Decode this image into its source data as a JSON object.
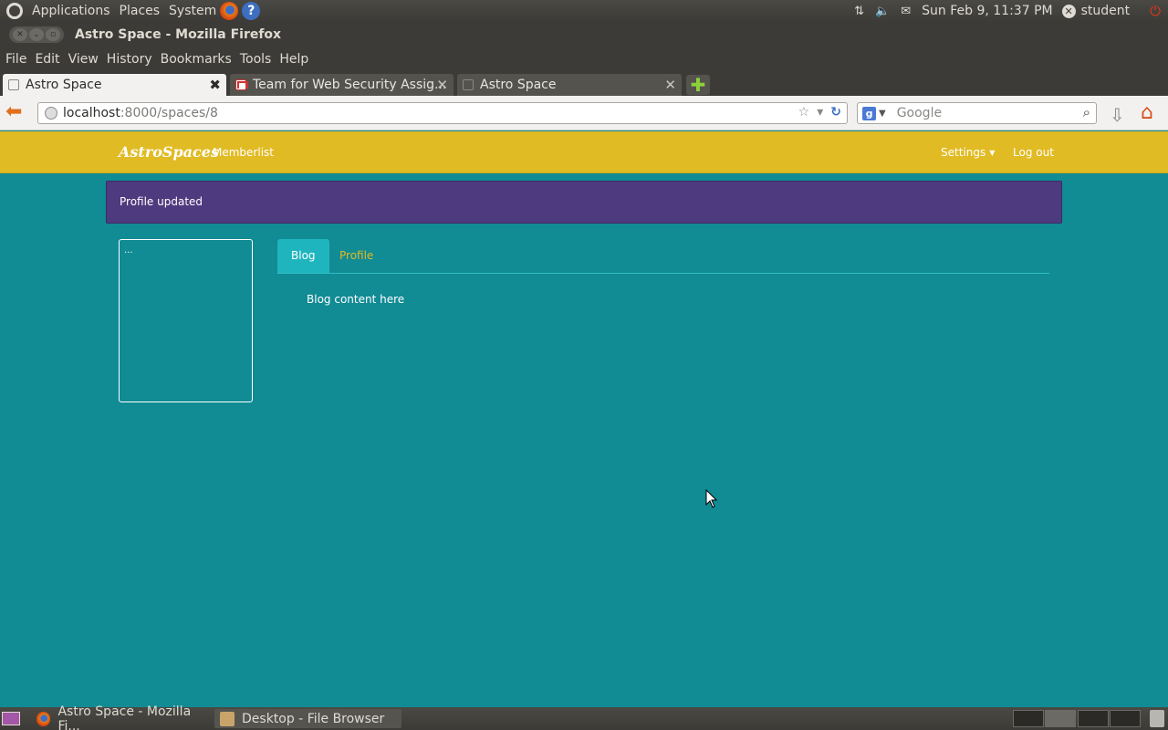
{
  "top_panel": {
    "menus": [
      "Applications",
      "Places",
      "System"
    ],
    "clock": "Sun Feb  9, 11:37 PM",
    "user": "student"
  },
  "window": {
    "title": "Astro Space - Mozilla Firefox"
  },
  "firefox_menu": [
    "File",
    "Edit",
    "View",
    "History",
    "Bookmarks",
    "Tools",
    "Help"
  ],
  "tabs": [
    {
      "title": "Astro Space",
      "active": true
    },
    {
      "title": "Team for Web Security Assig...",
      "active": false
    },
    {
      "title": "Astro Space",
      "active": false
    }
  ],
  "navbar": {
    "url_host": "localhost",
    "url_rest": ":8000/spaces/8",
    "search_placeholder": "Google"
  },
  "site": {
    "brand": "AstroSpaces",
    "nav_left": [
      "Memberlist"
    ],
    "settings_label": "Settings",
    "logout_label": "Log out",
    "alert": "Profile updated",
    "avatar_text": "...",
    "profile_tabs": [
      {
        "label": "Blog",
        "active": true
      },
      {
        "label": "Profile",
        "active": false
      }
    ],
    "blog_content": "Blog content here"
  },
  "taskbar": {
    "tasks": [
      {
        "label": "Astro Space - Mozilla Fi...",
        "icon": "firefox-icon"
      },
      {
        "label": "Desktop - File Browser",
        "icon": "file-browser-icon"
      }
    ]
  },
  "colors": {
    "page_bg": "#118b94",
    "navbar_bg": "#e1bb24",
    "alert_bg": "#4e3a7e",
    "active_tab_bg": "#1fb5bf"
  }
}
